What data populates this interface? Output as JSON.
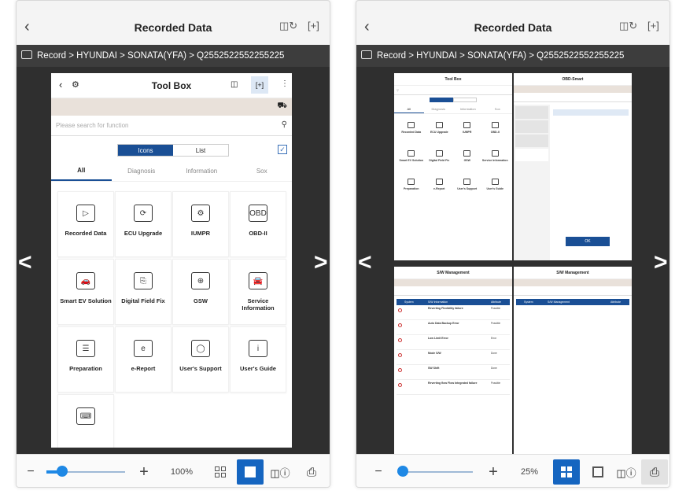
{
  "left": {
    "title": "Recorded Data",
    "breadcrumb": "Record > HYUNDAI > SONATA(YFA) > Q2552522552255225",
    "icons": {
      "back": "chevron-left-icon",
      "device": "device-sync-icon",
      "expand": "expand-icon",
      "prev": "arrow-left-icon",
      "next": "arrow-right-icon",
      "print": "printer-icon"
    },
    "screen": {
      "title": "Tool Box",
      "search_placeholder": "Please search for function",
      "toggle": [
        "Icons",
        "List"
      ],
      "tabs": [
        "All",
        "Diagnosis",
        "Information",
        "Sox"
      ],
      "tiles": [
        "Recorded Data",
        "ECU Upgrade",
        "IUMPR",
        "OBD-II",
        "Smart EV Solution",
        "Digital Field Fix",
        "GSW",
        "Service Information",
        "Preparation",
        "e-Report",
        "User's Support",
        "User's Guide"
      ],
      "tile_glyphs": [
        "▷",
        "⟳",
        "⚙",
        "OBD",
        "🚗",
        "⎘",
        "⊕",
        "🚘",
        "☰",
        "e",
        "◯",
        "i"
      ]
    },
    "toolbar": {
      "minus": "−",
      "plus": "+",
      "zoom": "100%",
      "zoom_fraction": 0.12
    }
  },
  "right": {
    "title": "Recorded Data",
    "breadcrumb": "Record > HYUNDAI > SONATA(YFA) > Q2552522552255225",
    "mini1": {
      "title": "Tool Box",
      "tabs": [
        "All",
        "Diagnosis",
        "Information",
        "Sox"
      ],
      "tiles": [
        "Recorded Data",
        "ECU Upgrade",
        "IUMPR",
        "OBD-II",
        "Smart EV Solution",
        "Digital Field Fix",
        "GSW",
        "Service Information",
        "Preparation",
        "e-Report",
        "User's Support",
        "User's Guide"
      ]
    },
    "mini2": {
      "title": "OBD-Smart",
      "ok": "OK"
    },
    "mini3": {
      "title": "S/W Management",
      "table_headers": [
        "System",
        "S/W Information",
        "Attribute"
      ],
      "rows": [
        {
          "title": "Reverting Flexibility failure",
          "status": "Possible"
        },
        {
          "title": "Auto Data Backup Error",
          "status": "Possible"
        },
        {
          "title": "Low Limit Error",
          "status": "Error"
        },
        {
          "title": "Mode S/W",
          "status": "Done"
        },
        {
          "title": "SW Shift",
          "status": "Done"
        },
        {
          "title": "Reverting flow Flow Integrated failure",
          "status": "Possible"
        }
      ]
    },
    "mini4": {
      "title": "S/W Management",
      "table_headers": [
        "System",
        "S/W Management",
        "Attribute"
      ]
    },
    "toolbar": {
      "minus": "−",
      "plus": "+",
      "zoom": "25%",
      "zoom_fraction": 0.02
    }
  },
  "colors": {
    "accent": "#1565c0",
    "dark_bar": "#3d3d3d",
    "stage": "#2f2f2f",
    "tan": "#e9e1da"
  }
}
